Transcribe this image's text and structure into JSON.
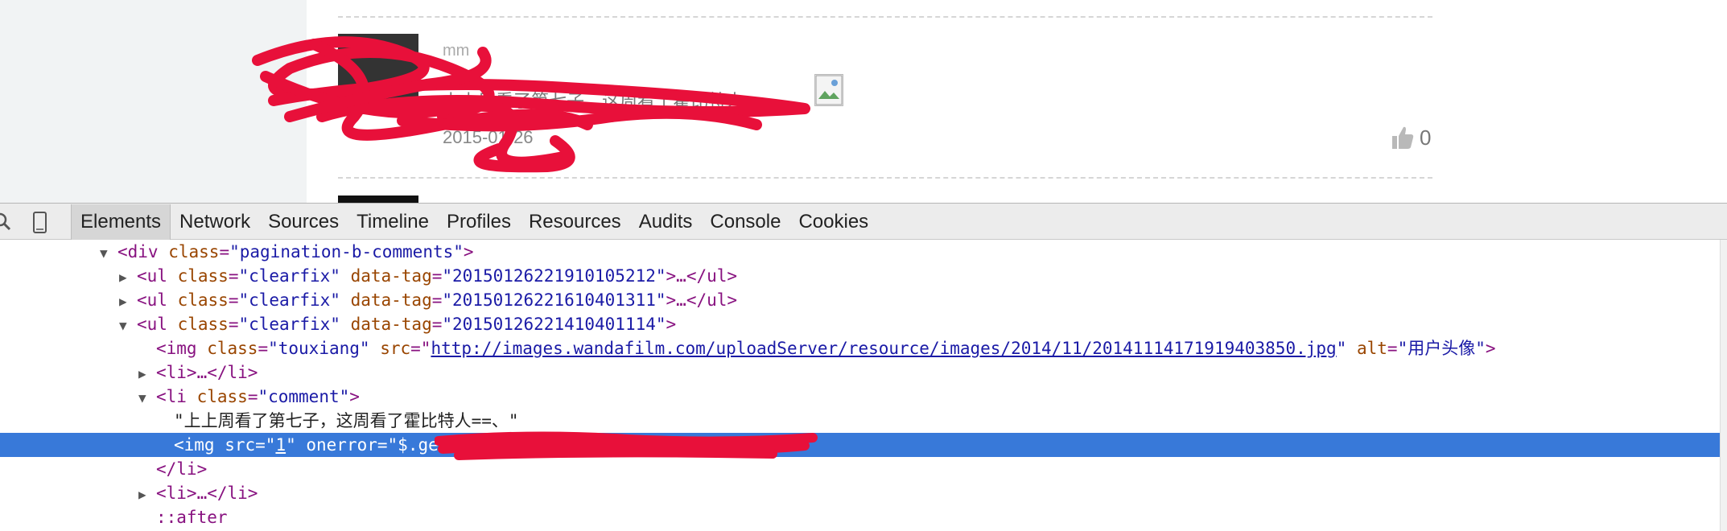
{
  "page": {
    "comment_user": "mm",
    "comment_text": "上上周看了第七子，这周看了霍比特人==",
    "comment_date": "2015-01-26",
    "like_count": "0"
  },
  "devtools": {
    "tabs": [
      "Elements",
      "Network",
      "Sources",
      "Timeline",
      "Profiles",
      "Resources",
      "Audits",
      "Console",
      "Cookies"
    ],
    "selected_tab": "Elements",
    "accent_color": "#3879d9",
    "tree": {
      "l1_tag_open": "<div",
      "l1_attr": "class",
      "l1_val": "\"pagination-b-comments\"",
      "l1_tag_close": ">",
      "ul_tag": "<ul",
      "class_attr": "class",
      "clearfix_val": "\"clearfix\"",
      "datatag_attr": "data-tag",
      "ul1_val": "\"20150126221910105212\"",
      "ul2_val": "\"20150126221610401311\"",
      "ul3_val": "\"20150126221410401114\"",
      "collapsed_ul_end": ">…</ul>",
      "gt": ">",
      "img_tag": "<img",
      "touxiang_val": "\"touxiang\"",
      "src_attr": "src",
      "img_src": "http://images.wandafilm.com/uploadServer/resource/images/2014/11/20141114171919403850.jpg",
      "alt_attr": "alt",
      "alt_val": "\"用户头像\"",
      "li_collapsed": "<li>…</li>",
      "li_tag": "<li",
      "comment_val": "\"comment\"",
      "text_node": "\"上上周看了第七子，这周看了霍比特人==、\"",
      "sel_img_open": "<img src=\"",
      "sel_src_val": "1",
      "sel_attr": "\" onerror=",
      "sel_onerror": "\"$.get(",
      "li_close": "</li>",
      "after": "::after"
    }
  }
}
